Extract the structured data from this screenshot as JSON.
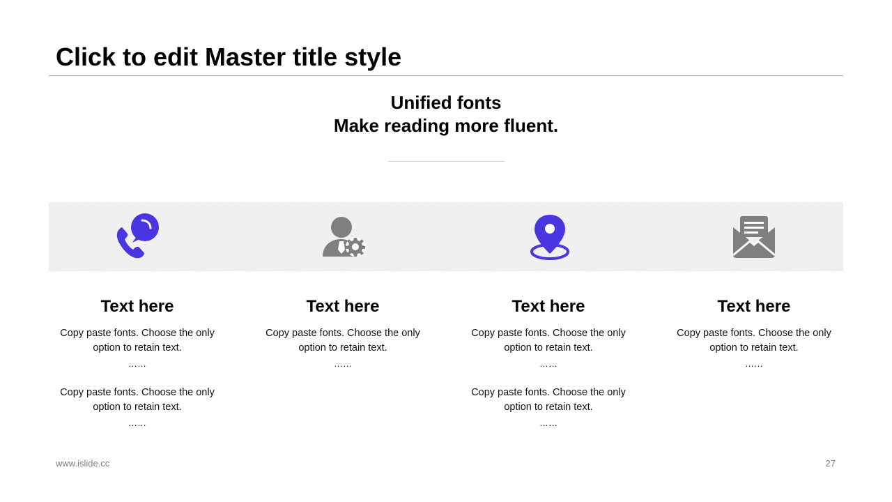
{
  "slide": {
    "title": "Click to edit Master title style",
    "subtitle_line1": "Unified fonts",
    "subtitle_line2": "Make reading more fluent.",
    "accent_color": "#4a36e0",
    "icon_gray": "#7f7f7f",
    "columns": [
      {
        "icon": "phone-chat-icon",
        "title": "Text here",
        "paragraphs": [
          {
            "line1": "Copy paste fonts. Choose the only",
            "line2": "option to retain text.",
            "dots": "……"
          },
          {
            "line1": "Copy paste fonts. Choose the only",
            "line2": "option to retain text.",
            "dots": "……"
          }
        ]
      },
      {
        "icon": "user-settings-icon",
        "title": "Text here",
        "paragraphs": [
          {
            "line1": "Copy paste fonts. Choose the only",
            "line2": "option to retain text.",
            "dots": "……"
          }
        ]
      },
      {
        "icon": "location-pin-icon",
        "title": "Text here",
        "paragraphs": [
          {
            "line1": "Copy paste fonts. Choose the only",
            "line2": "option to retain text.",
            "dots": "……"
          },
          {
            "line1": "Copy paste fonts. Choose the only",
            "line2": "option to retain text.",
            "dots": "……"
          }
        ]
      },
      {
        "icon": "envelope-open-icon",
        "title": "Text here",
        "paragraphs": [
          {
            "line1": "Copy paste fonts. Choose the only",
            "line2": "option to retain text.",
            "dots": "……"
          }
        ]
      }
    ],
    "footer_url": "www.islide.cc",
    "page_number": "27"
  }
}
